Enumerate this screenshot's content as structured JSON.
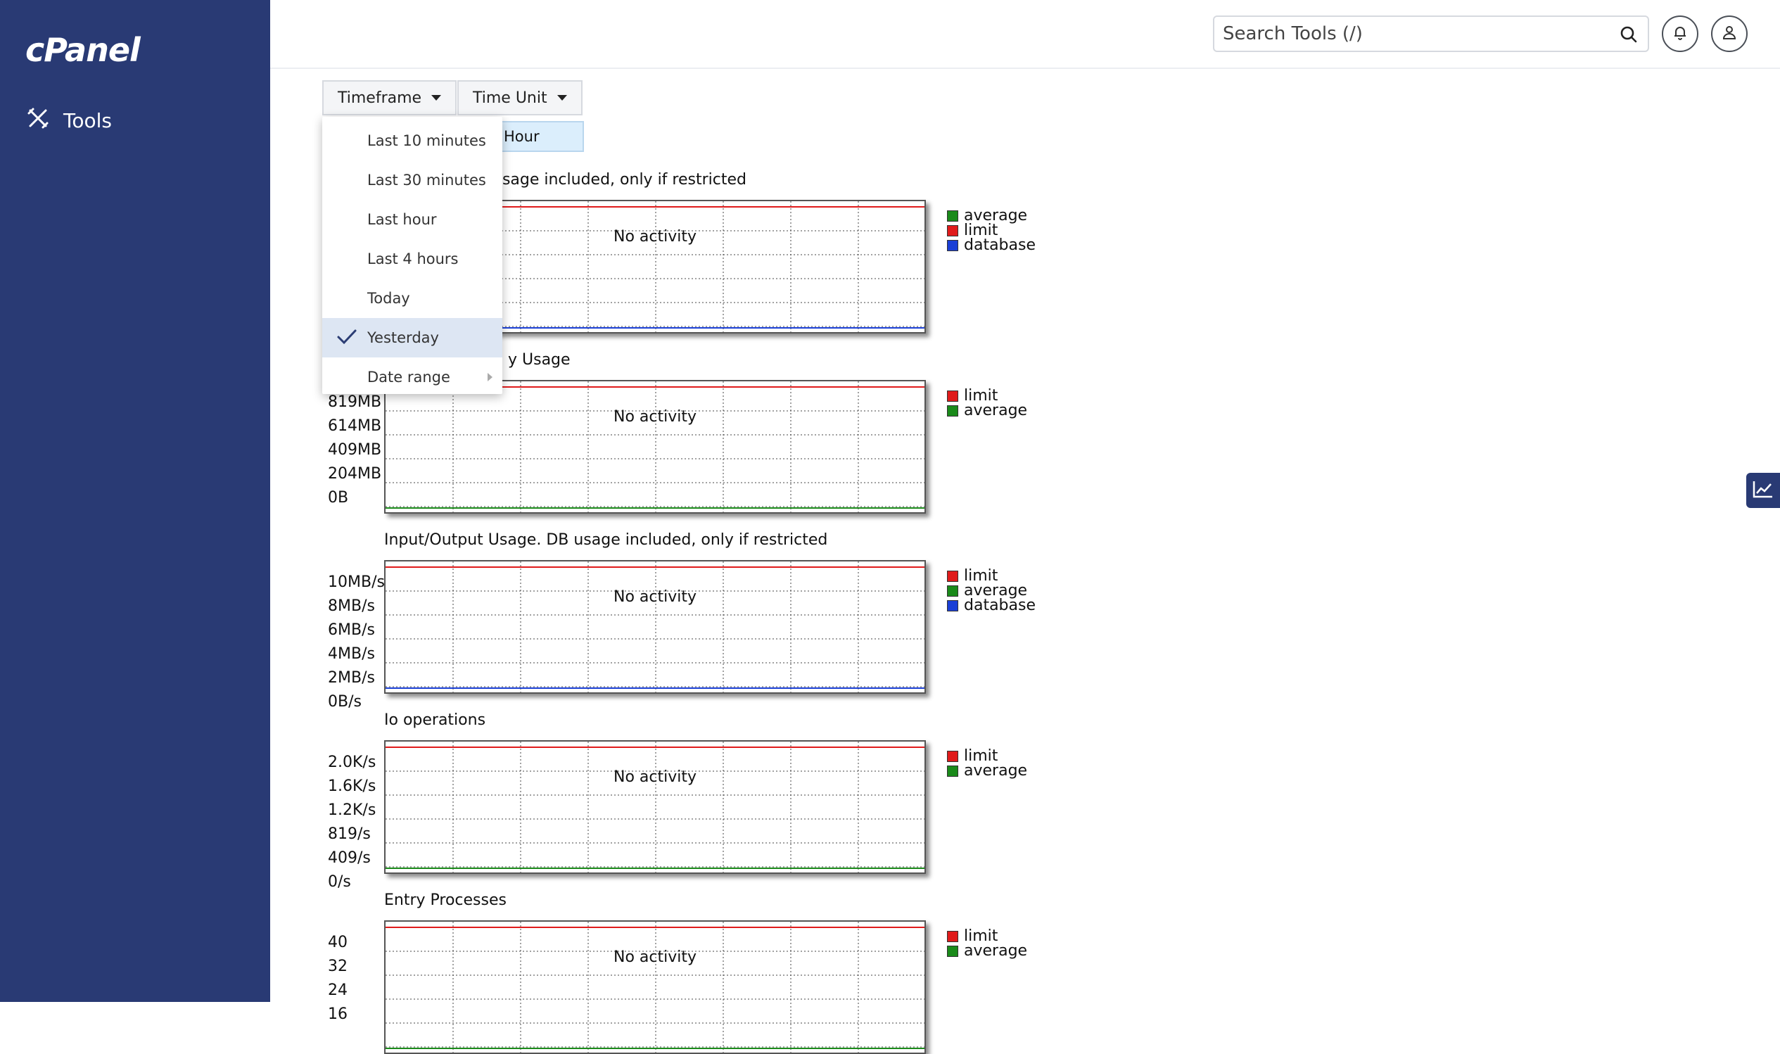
{
  "app": {
    "logo": "cPanel"
  },
  "sidebar": {
    "items": [
      {
        "label": "Tools",
        "icon": "tools-icon"
      }
    ]
  },
  "header": {
    "search_placeholder": "Search Tools (/)"
  },
  "toolbar": {
    "timeframe_label": "Timeframe",
    "timeunit_label": "Time Unit",
    "selected_unit": "Hour"
  },
  "timeframe_menu": {
    "items": [
      {
        "label": "Last 10 minutes",
        "selected": false
      },
      {
        "label": "Last 30 minutes",
        "selected": false
      },
      {
        "label": "Last hour",
        "selected": false
      },
      {
        "label": "Last 4 hours",
        "selected": false
      },
      {
        "label": "Today",
        "selected": false
      },
      {
        "label": "Yesterday",
        "selected": true
      },
      {
        "label": "Date range",
        "selected": false,
        "submenu": true
      }
    ]
  },
  "charts": [
    {
      "title": "usage included, only if restricted",
      "no_activity": "No activity",
      "yticks": [],
      "legend": [
        {
          "name": "average",
          "color": "#1a8a1a"
        },
        {
          "name": "limit",
          "color": "#e01b1b"
        },
        {
          "name": "database",
          "color": "#1a3fd6"
        }
      ]
    },
    {
      "title": "y Usage",
      "no_activity": "No activity",
      "yticks": [
        "819MB",
        "614MB",
        "409MB",
        "204MB",
        "0B"
      ],
      "legend": [
        {
          "name": "limit",
          "color": "#e01b1b"
        },
        {
          "name": "average",
          "color": "#1a8a1a"
        }
      ]
    },
    {
      "title": "Input/Output Usage. DB usage included, only if restricted",
      "no_activity": "No activity",
      "yticks": [
        "10MB/s",
        "8MB/s",
        "6MB/s",
        "4MB/s",
        "2MB/s",
        "0B/s"
      ],
      "legend": [
        {
          "name": "limit",
          "color": "#e01b1b"
        },
        {
          "name": "average",
          "color": "#1a8a1a"
        },
        {
          "name": "database",
          "color": "#1a3fd6"
        }
      ]
    },
    {
      "title": "Io operations",
      "no_activity": "No activity",
      "yticks": [
        "2.0K/s",
        "1.6K/s",
        "1.2K/s",
        "819/s",
        "409/s",
        "0/s"
      ],
      "legend": [
        {
          "name": "limit",
          "color": "#e01b1b"
        },
        {
          "name": "average",
          "color": "#1a8a1a"
        }
      ]
    },
    {
      "title": "Entry Processes",
      "no_activity": "No activity",
      "yticks": [
        "40",
        "32",
        "24",
        "16"
      ],
      "legend": [
        {
          "name": "limit",
          "color": "#e01b1b"
        },
        {
          "name": "average",
          "color": "#1a8a1a"
        }
      ]
    }
  ]
}
